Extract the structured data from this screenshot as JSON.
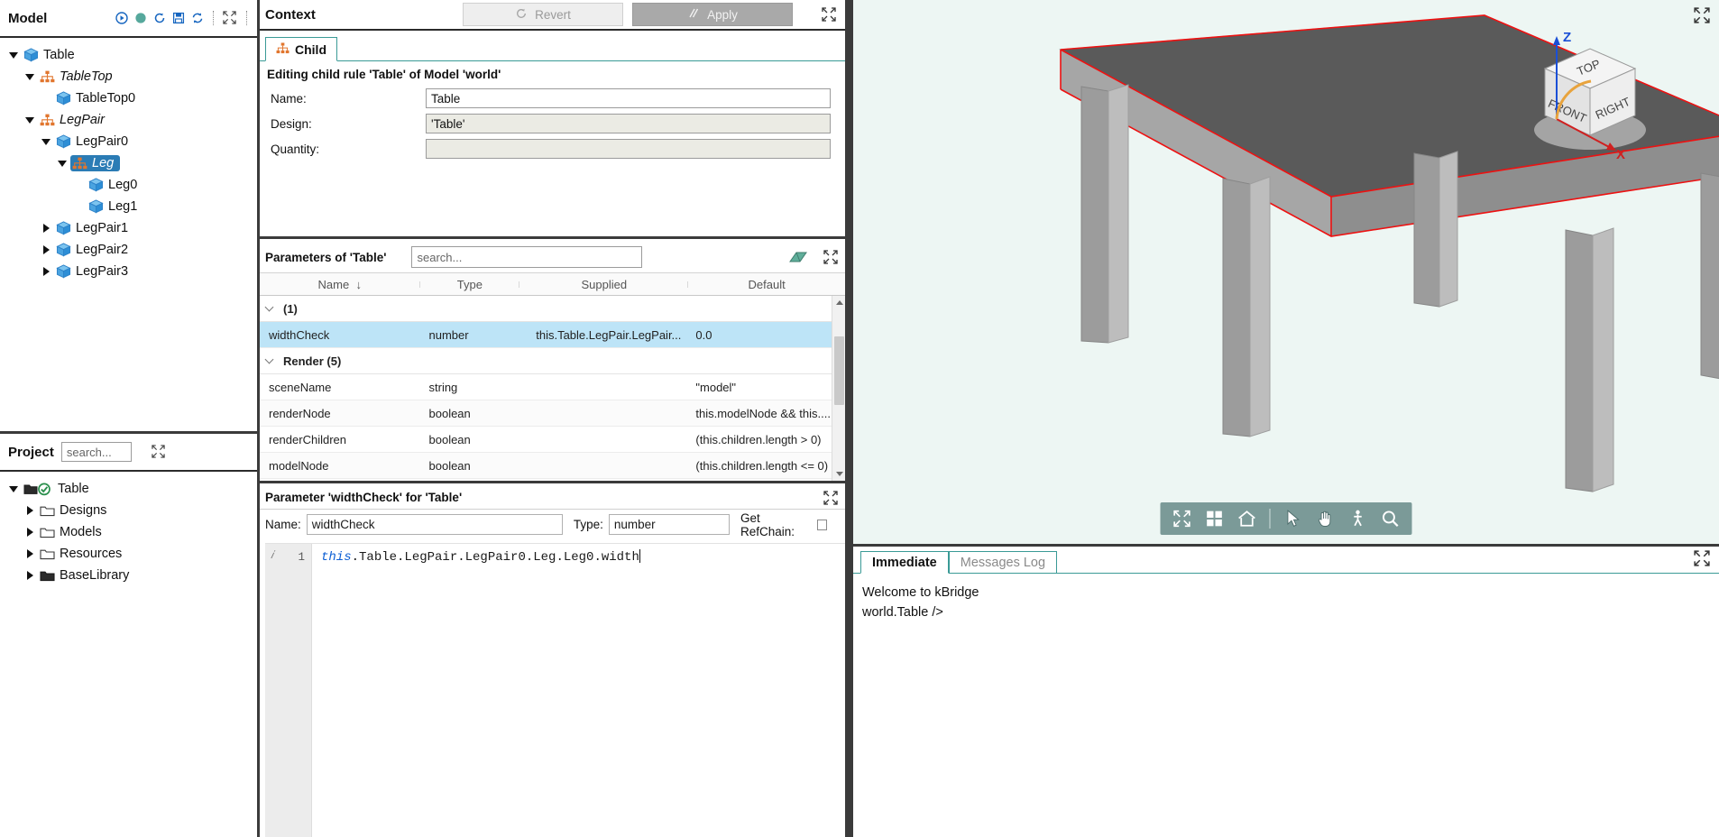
{
  "app": {
    "name": "kBridge"
  },
  "model_panel": {
    "title": "Model",
    "toolbar_icons": [
      "run-icon",
      "status-dot-icon",
      "history-icon",
      "save-icon",
      "refresh-icon"
    ],
    "tree": [
      {
        "label": "Table",
        "indent": 0,
        "twisty": "down",
        "icon": "cube-icon",
        "italic": false,
        "selected": false
      },
      {
        "label": "TableTop",
        "indent": 1,
        "twisty": "down",
        "icon": "rule-icon",
        "italic": true,
        "selected": false
      },
      {
        "label": "TableTop0",
        "indent": 2,
        "twisty": "none",
        "icon": "cube-icon",
        "italic": false,
        "selected": false
      },
      {
        "label": "LegPair",
        "indent": 1,
        "twisty": "down",
        "icon": "rule-icon",
        "italic": true,
        "selected": false
      },
      {
        "label": "LegPair0",
        "indent": 2,
        "twisty": "down",
        "icon": "cube-icon",
        "italic": false,
        "selected": false
      },
      {
        "label": "Leg",
        "indent": 3,
        "twisty": "down",
        "icon": "rule-icon",
        "italic": true,
        "selected": true
      },
      {
        "label": "Leg0",
        "indent": 4,
        "twisty": "none",
        "icon": "cube-icon",
        "italic": false,
        "selected": false
      },
      {
        "label": "Leg1",
        "indent": 4,
        "twisty": "none",
        "icon": "cube-icon",
        "italic": false,
        "selected": false
      },
      {
        "label": "LegPair1",
        "indent": 2,
        "twisty": "right",
        "icon": "cube-icon",
        "italic": false,
        "selected": false
      },
      {
        "label": "LegPair2",
        "indent": 2,
        "twisty": "right",
        "icon": "cube-icon",
        "italic": false,
        "selected": false
      },
      {
        "label": "LegPair3",
        "indent": 2,
        "twisty": "right",
        "icon": "cube-icon",
        "italic": false,
        "selected": false
      }
    ]
  },
  "project_panel": {
    "title": "Project",
    "search_placeholder": "search...",
    "tree": [
      {
        "label": "Table",
        "indent": 0,
        "twisty": "down",
        "icon": "project-check-icon"
      },
      {
        "label": "Designs",
        "indent": 1,
        "twisty": "right",
        "icon": "folder-icon"
      },
      {
        "label": "Models",
        "indent": 1,
        "twisty": "right",
        "icon": "folder-icon"
      },
      {
        "label": "Resources",
        "indent": 1,
        "twisty": "right",
        "icon": "folder-icon"
      },
      {
        "label": "BaseLibrary",
        "indent": 1,
        "twisty": "right",
        "icon": "folder-black-icon"
      }
    ]
  },
  "context_panel": {
    "title": "Context",
    "revert_label": "Revert",
    "apply_label": "Apply",
    "tab_label": "Child",
    "description": "Editing child rule 'Table' of Model 'world'",
    "fields": [
      {
        "label": "Name:",
        "value": "Table",
        "readonly": false
      },
      {
        "label": "Design:",
        "value": "'Table'",
        "readonly": true
      },
      {
        "label": "Quantity:",
        "value": "",
        "readonly": true
      }
    ]
  },
  "params_panel": {
    "title": "Parameters of 'Table'",
    "search_placeholder": "search...",
    "columns": [
      "Name",
      "Type",
      "Supplied",
      "Default"
    ],
    "sort_column": "Name",
    "sort_direction": "down",
    "rows": [
      {
        "kind": "group",
        "label": "(1)"
      },
      {
        "kind": "param",
        "name": "widthCheck",
        "type": "number",
        "supplied": "this.Table.LegPair.LegPair...",
        "default": "0.0",
        "selected": true
      },
      {
        "kind": "group",
        "label": "Render (5)"
      },
      {
        "kind": "param",
        "name": "sceneName",
        "type": "string",
        "supplied": "",
        "default": "\"model\"",
        "selected": false
      },
      {
        "kind": "param",
        "name": "renderNode",
        "type": "boolean",
        "supplied": "",
        "default": "this.modelNode && this....",
        "selected": false
      },
      {
        "kind": "param",
        "name": "renderChildren",
        "type": "boolean",
        "supplied": "",
        "default": "(this.children.length > 0)",
        "selected": false
      },
      {
        "kind": "param",
        "name": "modelNode",
        "type": "boolean",
        "supplied": "",
        "default": "(this.children.length <= 0)",
        "selected": false
      }
    ]
  },
  "param_editor": {
    "title": "Parameter 'widthCheck' for 'Table'",
    "name_label": "Name:",
    "name_value": "widthCheck",
    "type_label": "Type:",
    "type_value": "number",
    "refchain_label": "Get RefChain:",
    "refchain_checked": false,
    "line_number": "1",
    "code_keyword": "this",
    "code_rest": ".Table.LegPair.LegPair0.Leg.Leg0.width"
  },
  "viewport": {
    "axis_labels": {
      "z": "Z",
      "x": "X"
    },
    "viewcube_faces": {
      "top": "TOP",
      "front": "FRONT",
      "right": "RIGHT"
    },
    "toolbar_tools": [
      "fit-all-icon",
      "grid-icon",
      "home-icon",
      "select-arrow-icon",
      "pan-hand-icon",
      "walk-icon",
      "zoom-magnifier-icon"
    ],
    "colors": {
      "background": "#edf6f3",
      "surface_top": "#5b5b5b",
      "surface_side": "#9d9d9d",
      "highlight_edge": "#ee1111",
      "axis_z": "#1a4fd6",
      "axis_x": "#d02020"
    }
  },
  "console_panel": {
    "tabs": [
      {
        "label": "Immediate",
        "active": true
      },
      {
        "label": "Messages Log",
        "active": false
      }
    ],
    "lines": [
      "Welcome to kBridge",
      "world.Table />"
    ]
  }
}
